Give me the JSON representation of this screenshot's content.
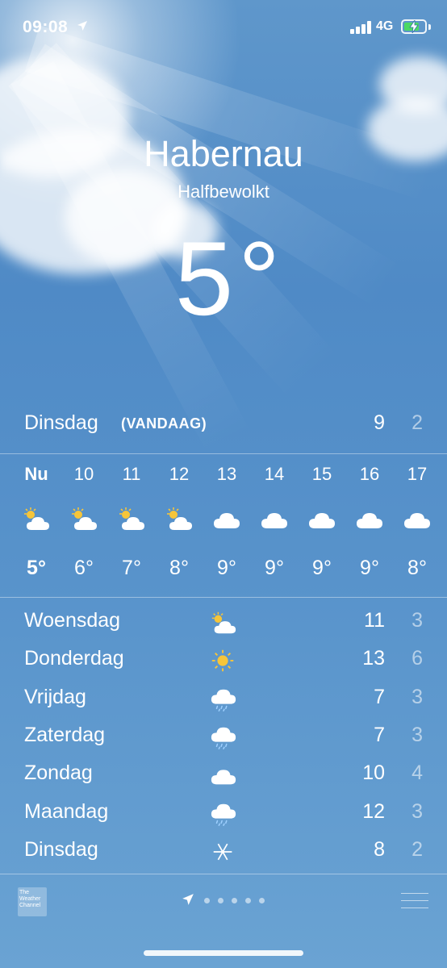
{
  "status_bar": {
    "time": "09:08",
    "network": "4G",
    "battery_level": 0.75,
    "battery_color": "#4cd964"
  },
  "location": {
    "city": "Habernau",
    "condition": "Halfbewolkt",
    "temperature_value": "5",
    "temperature_unit": "°"
  },
  "today": {
    "day": "Dinsdag",
    "tag": "(VANDAAG)",
    "high": "9",
    "low": "2"
  },
  "hourly": [
    {
      "label": "Nu",
      "icon": "partly-sunny-icon",
      "temp": "5°"
    },
    {
      "label": "10",
      "icon": "partly-sunny-icon",
      "temp": "6°"
    },
    {
      "label": "11",
      "icon": "partly-sunny-icon",
      "temp": "7°"
    },
    {
      "label": "12",
      "icon": "partly-sunny-icon",
      "temp": "8°"
    },
    {
      "label": "13",
      "icon": "cloud-icon",
      "temp": "9°"
    },
    {
      "label": "14",
      "icon": "cloud-icon",
      "temp": "9°"
    },
    {
      "label": "15",
      "icon": "cloud-icon",
      "temp": "9°"
    },
    {
      "label": "16",
      "icon": "cloud-icon",
      "temp": "9°"
    },
    {
      "label": "17",
      "icon": "cloud-icon",
      "temp": "8°"
    }
  ],
  "daily": [
    {
      "day": "Woensdag",
      "icon": "partly-sunny-icon",
      "high": "11",
      "low": "3"
    },
    {
      "day": "Donderdag",
      "icon": "sun-icon",
      "high": "13",
      "low": "6"
    },
    {
      "day": "Vrijdag",
      "icon": "rain-cloud-icon",
      "high": "7",
      "low": "3"
    },
    {
      "day": "Zaterdag",
      "icon": "rain-cloud-icon",
      "high": "7",
      "low": "3"
    },
    {
      "day": "Zondag",
      "icon": "cloud-icon",
      "high": "10",
      "low": "4"
    },
    {
      "day": "Maandag",
      "icon": "rain-cloud-icon",
      "high": "12",
      "low": "3"
    },
    {
      "day": "Dinsdag",
      "icon": "snowflake-icon",
      "high": "8",
      "low": "2"
    }
  ],
  "footer": {
    "logo_text": "The Weather Channel",
    "page_count": 5
  },
  "colors": {
    "sun": "#f6c53a",
    "text": "#ffffff"
  }
}
